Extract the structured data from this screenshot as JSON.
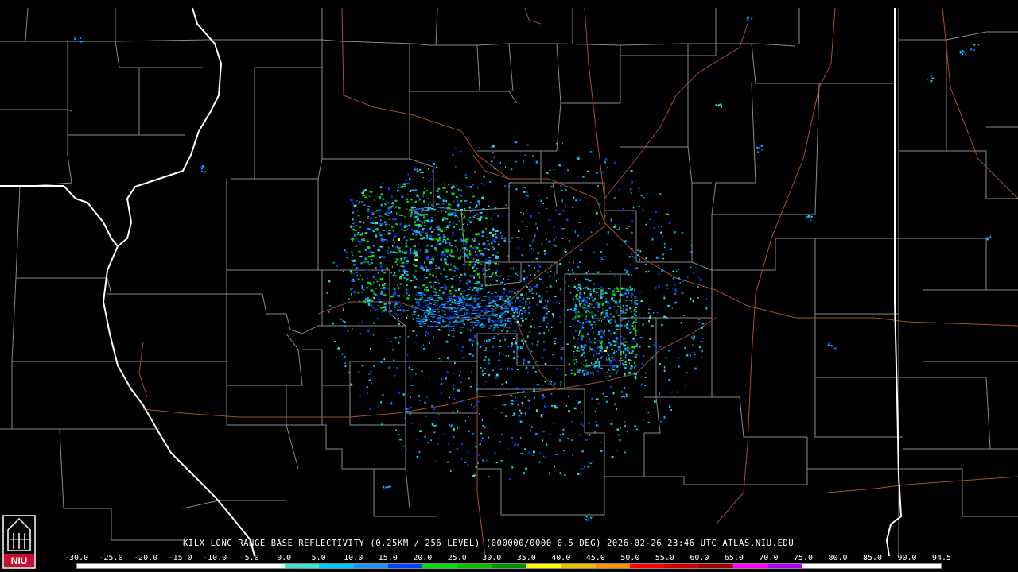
{
  "caption": {
    "station": "KILX",
    "product": "LONG RANGE BASE REFLECTIVITY",
    "resolution": "(0.25KM / 256 LEVEL)",
    "volume": "(000000/0000 0.5 DEG)",
    "timestamp": "2026-02-26 23:46 UTC",
    "source": "ATLAS.NIU.EDU"
  },
  "logo": {
    "text": "NIU",
    "icon": "university-tower-icon"
  },
  "scale": {
    "labels": [
      "-30.0",
      "-25.0",
      "-20.0",
      "-15.0",
      "-10.0",
      "-5.0",
      "0.0",
      "5.0",
      "10.0",
      "15.0",
      "20.0",
      "25.0",
      "30.0",
      "35.0",
      "40.0",
      "45.0",
      "50.0",
      "55.0",
      "60.0",
      "65.0",
      "70.0",
      "75.0",
      "80.0",
      "85.0",
      "90.0",
      "94.5"
    ],
    "colors": [
      "#ffffff",
      "#ffffff",
      "#ffffff",
      "#ffffff",
      "#ffffff",
      "#ffffff",
      "#40e0d0",
      "#00c8ff",
      "#1e90ff",
      "#0040ff",
      "#00e000",
      "#00c000",
      "#009000",
      "#ffff00",
      "#e8c000",
      "#ff9000",
      "#ff0000",
      "#d00000",
      "#a00000",
      "#ff00ff",
      "#b000ff",
      "#ffffff",
      "#ffffff",
      "#ffffff",
      "#ffffff"
    ]
  },
  "colors": {
    "state_border": "#ffffff",
    "county_border": "#8a8a8a",
    "highway": "#a0522d",
    "background": "#000000"
  }
}
